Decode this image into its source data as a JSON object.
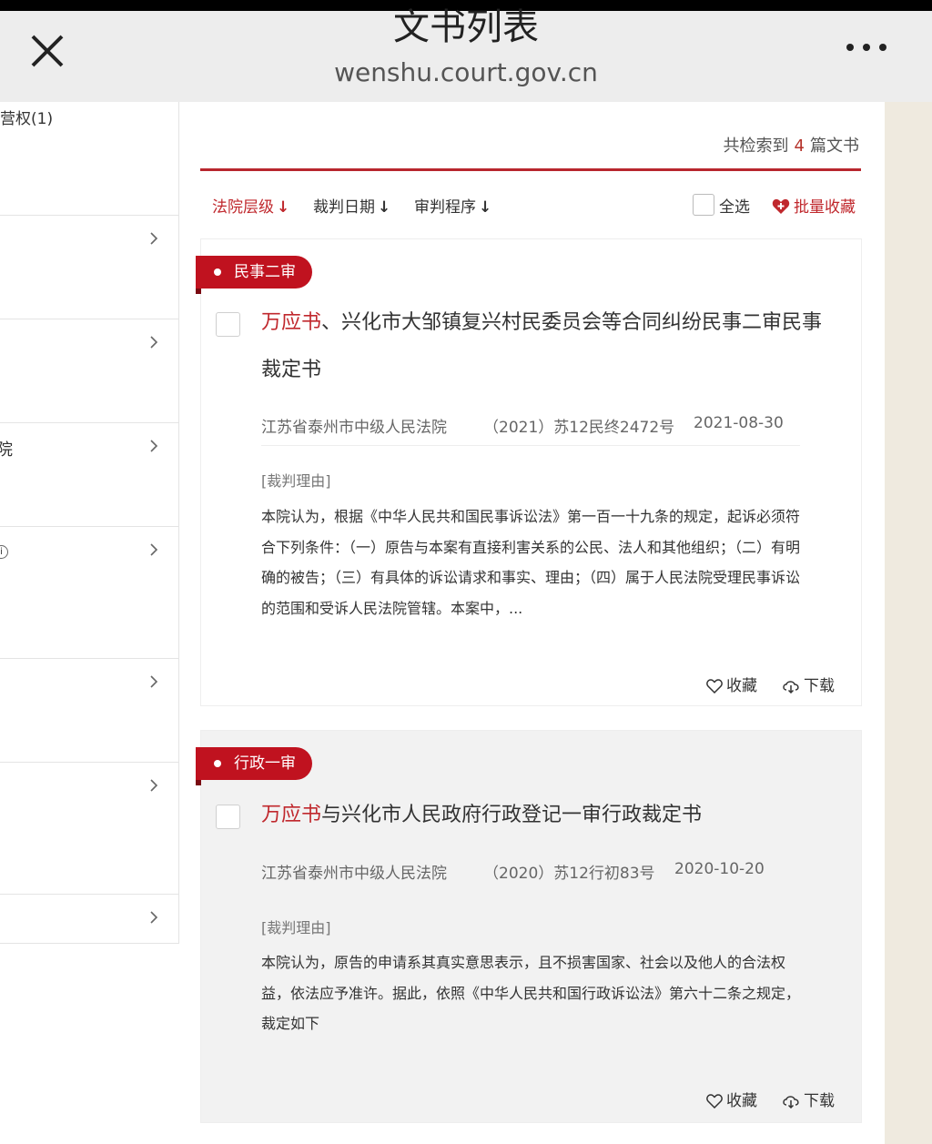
{
  "header": {
    "title": "文书列表",
    "url": "wenshu.court.gov.cn"
  },
  "sidebar": {
    "top_item": "营权(1)",
    "rows": [
      {
        "label": ""
      },
      {
        "label": ""
      },
      {
        "label": "院"
      },
      {
        "label": ""
      },
      {
        "label": ""
      },
      {
        "label": ""
      },
      {
        "label": ""
      }
    ]
  },
  "results": {
    "prefix": "共检索到",
    "count": "4",
    "suffix": "篇文书"
  },
  "sortbar": {
    "court_level": "法院层级",
    "judge_date": "裁判日期",
    "trial_procedure": "审判程序",
    "select_all": "全选",
    "batch_favorite": "批量收藏"
  },
  "documents": [
    {
      "tag": "民事二审",
      "title_highlight": "万应书",
      "title_rest": "、兴化市大邹镇复兴村民委员会等合同纠纷民事二审民事裁定书",
      "court": "江苏省泰州市中级人民法院",
      "case_no": "（2021）苏12民终2472号",
      "date": "2021-08-30",
      "section_label": "[裁判理由]",
      "reason": "本院认为，根据《中华人民共和国民事诉讼法》第一百一十九条的规定，起诉必须符合下列条件：（一）原告与本案有直接利害关系的公民、法人和其他组织；（二）有明确的被告；（三）有具体的诉讼请求和事实、理由；（四）属于人民法院受理民事诉讼的范围和受诉人民法院管辖。本案中，...",
      "favorite": "收藏",
      "download": "下载"
    },
    {
      "tag": "行政一审",
      "title_highlight": "万应书",
      "title_rest": "与兴化市人民政府行政登记一审行政裁定书",
      "court": "江苏省泰州市中级人民法院",
      "case_no": "（2020）苏12行初83号",
      "date": "2020-10-20",
      "section_label": "[裁判理由]",
      "reason": "本院认为，原告的申请系其真实意思表示，且不损害国家、社会以及他人的合法权益，依法应予准许。据此，依照《中华人民共和国行政诉讼法》第六十二条之规定，裁定如下",
      "favorite": "收藏",
      "download": "下载"
    }
  ],
  "colors": {
    "accent": "#c0282d",
    "tag_bg": "#c0121f",
    "side_panel": "#efeadf"
  }
}
